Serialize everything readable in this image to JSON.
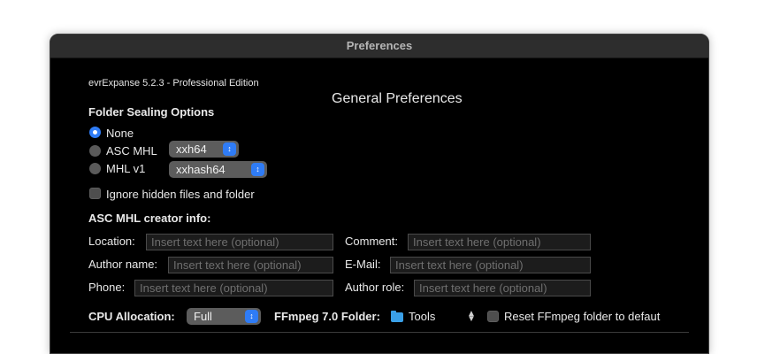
{
  "window": {
    "title": "Preferences"
  },
  "app_version": "evrExpanse 5.2.3 - Professional Edition",
  "page_heading": "General Preferences",
  "folder_sealing": {
    "label": "Folder Sealing Options",
    "options": [
      {
        "label": "None",
        "selected": true
      },
      {
        "label": "ASC MHL",
        "selected": false,
        "hash": "xxh64"
      },
      {
        "label": "MHL v1",
        "selected": false,
        "hash": "xxhash64"
      }
    ]
  },
  "ignore_hidden": {
    "label": "Ignore hidden files and folder",
    "checked": false
  },
  "creator_info": {
    "label": "ASC MHL creator info:",
    "location_label": "Location:",
    "comment_label": "Comment:",
    "author_name_label": "Author name:",
    "email_label": "E-Mail:",
    "phone_label": "Phone:",
    "author_role_label": "Author role:",
    "placeholder": "Insert text here (optional)"
  },
  "cpu": {
    "label": "CPU Allocation:",
    "value": "Full"
  },
  "ffmpeg": {
    "label": "FFmpeg 7.0 Folder:",
    "folder": "Tools",
    "reset_label": "Reset FFmpeg folder to defaut",
    "reset_checked": false
  },
  "colors": {
    "accent": "#2f7cf6",
    "folder": "#3aa0e8",
    "window_bg": "#000000",
    "titlebar": "#2d2d2d"
  },
  "icons": {
    "folder": "folder-icon",
    "updown": "updown-chevron-icon"
  }
}
